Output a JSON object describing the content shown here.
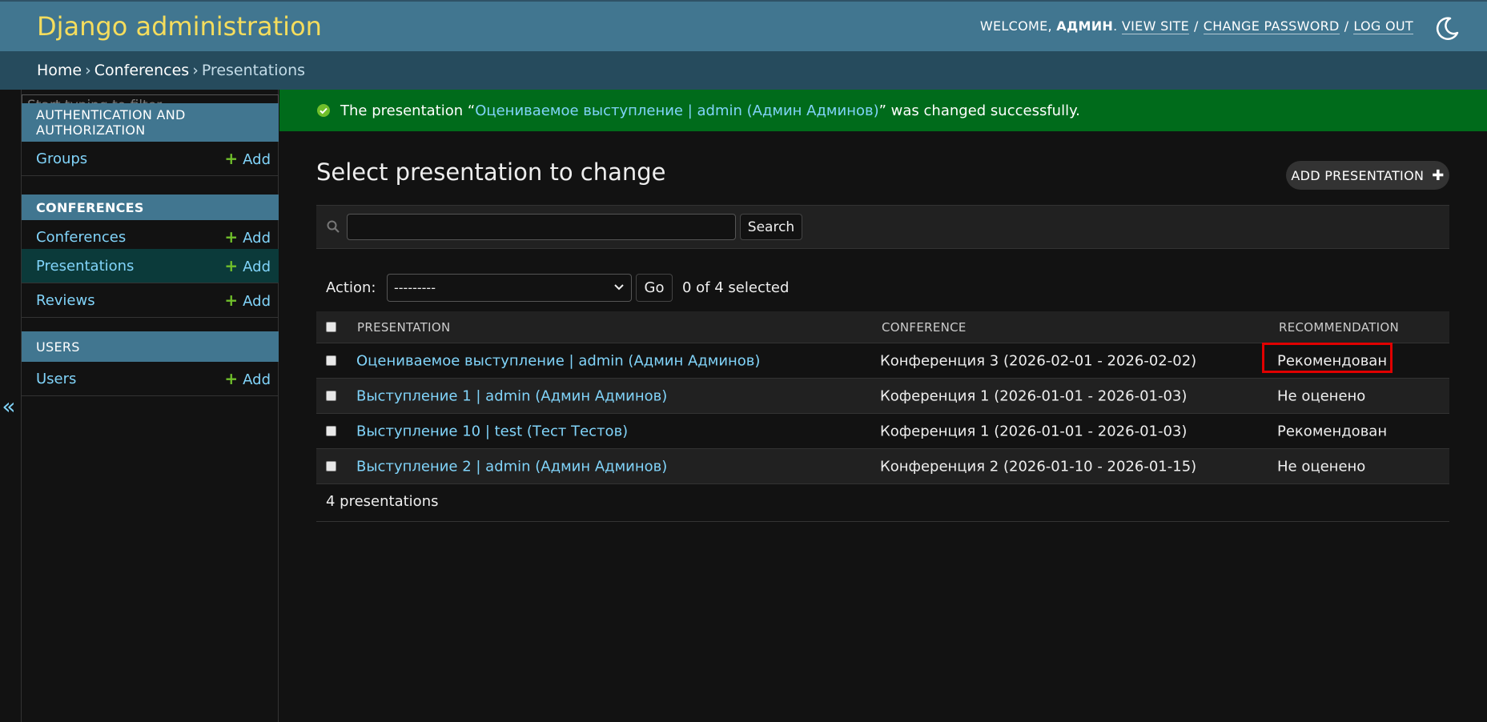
{
  "header": {
    "site_title": "Django administration",
    "welcome": "WELCOME, ",
    "username": "АДМИН",
    "welcome_suffix": ". ",
    "view_site": "VIEW SITE",
    "change_password": "CHANGE PASSWORD",
    "log_out": "LOG OUT",
    "separator": "/"
  },
  "breadcrumbs": {
    "home": "Home",
    "app": "Conferences",
    "current": "Presentations",
    "separator": "›"
  },
  "sidebar": {
    "filter_placeholder": "Start typing to filter…",
    "add_label": "Add",
    "toggle_label": "«",
    "modules": [
      {
        "caption": "AUTHENTICATION AND AUTHORIZATION",
        "items": [
          {
            "label": "Groups"
          }
        ]
      },
      {
        "caption": "CONFERENCES",
        "items": [
          {
            "label": "Conferences"
          },
          {
            "label": "Presentations",
            "current": true
          },
          {
            "label": "Reviews"
          }
        ]
      },
      {
        "caption": "USERS",
        "items": [
          {
            "label": "Users"
          }
        ]
      }
    ]
  },
  "message": {
    "prefix": "The presentation “",
    "link": "Оцениваемое выступление | admin (Админ Админов)",
    "suffix": "” was changed successfully.",
    "color": "#006b1b"
  },
  "content": {
    "title": "Select presentation to change",
    "add_button": "ADD PRESENTATION",
    "search_button": "Search",
    "search_value": "",
    "action_label": "Action:",
    "action_selected": "---------",
    "go_button": "Go",
    "selected_count": "0 of 4 selected",
    "columns": [
      "PRESENTATION",
      "CONFERENCE",
      "RECOMMENDATION"
    ],
    "rows": [
      {
        "presentation": "Оцениваемое выступление | admin (Админ Админов)",
        "conference": "Конференция 3 (2026-02-01 - 2026-02-02)",
        "recommendation": "Рекомендован",
        "highlighted": true
      },
      {
        "presentation": "Выступление 1 | admin (Админ Админов)",
        "conference": "Коференция 1 (2026-01-01 - 2026-01-03)",
        "recommendation": "Не оценено"
      },
      {
        "presentation": "Выступление 10 | test (Тест Тестов)",
        "conference": "Коференция 1 (2026-01-01 - 2026-01-03)",
        "recommendation": "Рекомендован"
      },
      {
        "presentation": "Выступление 2 | admin (Админ Админов)",
        "conference": "Конференция 2 (2026-01-10 - 2026-01-15)",
        "recommendation": "Не оценено"
      }
    ],
    "paginator": "4 presentations"
  },
  "colors": {
    "header_bg": "#417690",
    "breadcrumbs_bg": "#264b5d",
    "brand_yellow": "#f5dd5d",
    "link": "#81d4fa",
    "add_green": "#70bf2b",
    "highlight_red": "#e00000"
  },
  "icons": [
    "moon-icon",
    "check-circle-icon",
    "search-icon",
    "chevron-down-icon",
    "plus-icon",
    "double-chevron-left-icon"
  ]
}
